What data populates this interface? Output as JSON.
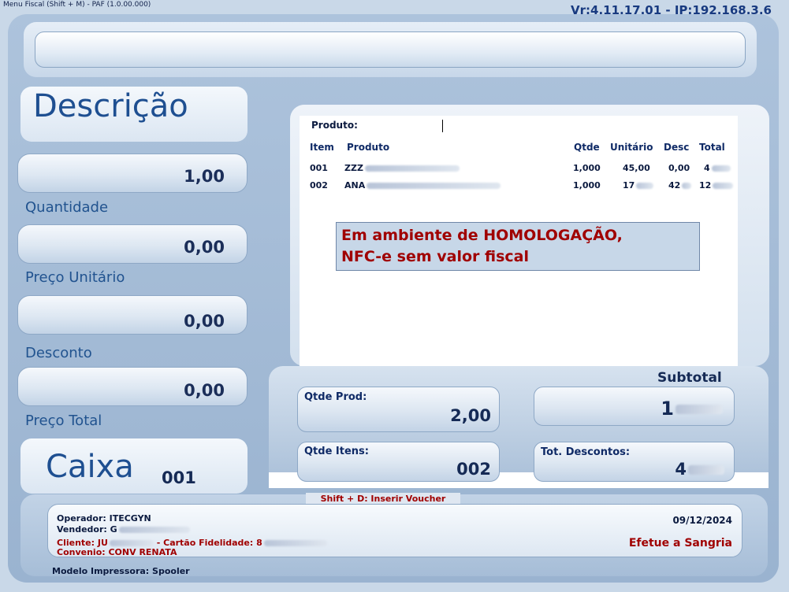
{
  "window": {
    "title": "Menu Fiscal (Shift + M) - PAF (1.0.00.000)",
    "version": "Vr:4.11.17.01 - IP:192.168.3.6"
  },
  "left": {
    "descricao_title": "Descrição",
    "fields": [
      {
        "value": "1,00",
        "label": "Quantidade"
      },
      {
        "value": "0,00",
        "label": "Preço Unitário"
      },
      {
        "value": "0,00",
        "label": "Desconto"
      },
      {
        "value": "0,00",
        "label": "Preço Total"
      }
    ],
    "caixa_title": "Caixa",
    "caixa_number": "001"
  },
  "items_panel": {
    "produto_label": "Produto:",
    "headers": {
      "item": "Item",
      "produto": "Produto",
      "qtde": "Qtde",
      "unitario": "Unitário",
      "desc": "Desc",
      "total": "Total"
    },
    "rows": [
      {
        "item": "001",
        "produto": "ZZZ",
        "qtde": "1,000",
        "unitario": "45,00",
        "desc": "0,00",
        "total": "4"
      },
      {
        "item": "002",
        "produto": "ANA",
        "qtde": "1,000",
        "unitario": "17",
        "desc": "42",
        "total": "12"
      }
    ],
    "warning_line1": "Em ambiente de HOMOLOGAÇÃO,",
    "warning_line2": "NFC-e sem valor fiscal"
  },
  "summary": {
    "subtotal_label": "Subtotal",
    "subtotal_value": "1",
    "qtde_prod_label": "Qtde Prod:",
    "qtde_prod_value": "2,00",
    "qtde_itens_label": "Qtde Itens:",
    "qtde_itens_value": "002",
    "tot_descontos_label": "Tot. Descontos:",
    "tot_descontos_value": "4"
  },
  "shortcut": "Shift + D: Inserir Voucher",
  "footer": {
    "operador": "Operador:  ITECGYN",
    "vendedor": "Vendedor:  G",
    "cliente_prefix": "Cliente:  JU",
    "cliente_mid": " - Cartão Fidelidade: 8",
    "convenio": "Convenio:  CONV RENATA",
    "date": "09/12/2024",
    "sangria": "Efetue a Sangria",
    "impressora": "Modelo Impressora:  Spooler"
  },
  "colors": {
    "accent": "#1e4f91",
    "warning": "#a00000"
  }
}
